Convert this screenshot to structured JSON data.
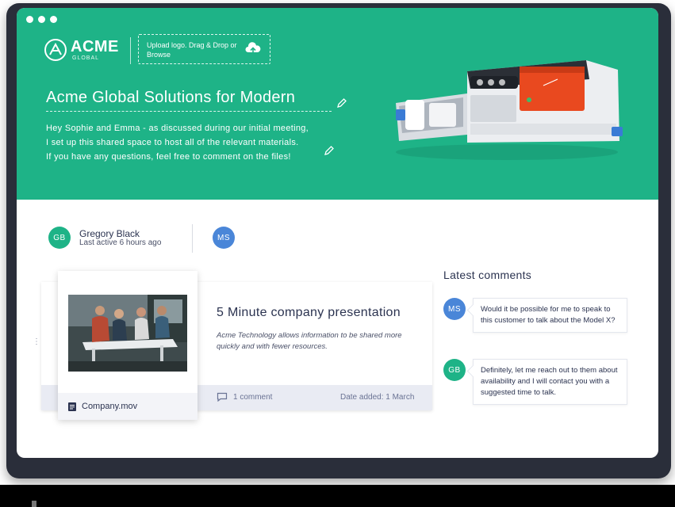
{
  "window": {
    "traffic_lights": [
      "dot",
      "dot",
      "dot"
    ]
  },
  "header": {
    "logo_word": "ACME",
    "logo_sub": "GLOBAL",
    "upload_text": "Upload logo. Drag & Drop or Browse",
    "upload_icon": "cloud-upload-icon",
    "title": "Acme Global Solutions for Modern",
    "description_lines": [
      "Hey Sophie and Emma - as discussed during our initial meeting,",
      "I set up this shared space to host all of the relevant materials.",
      "If you have any questions, feel free to comment on the files!"
    ],
    "edit_icon": "pencil-icon",
    "accent_color": "#1eb387"
  },
  "people": [
    {
      "initials": "GB",
      "name": "Gregory Black",
      "status": "Last active 6 hours ago",
      "color": "#1eb387"
    },
    {
      "initials": "MS",
      "color": "#4a86d8"
    }
  ],
  "card": {
    "title": "5 Minute company presentation",
    "description": "Acme Technology allows information to be shared more quickly and with fewer resources.",
    "comment_count": "1 comment",
    "date_added": "Date added: 1 March",
    "file_name": "Company.mov",
    "file_icon": "document-icon",
    "comment_icon": "speech-bubble-icon"
  },
  "comments": {
    "title": "Latest comments",
    "items": [
      {
        "initials": "MS",
        "color": "#4a86d8",
        "text": "Would it be possible for me to speak to this customer to talk about the Model X?"
      },
      {
        "initials": "GB",
        "color": "#1eb387",
        "text": "Definitely, let me reach out to them about availability and I will contact you with a suggested time to talk."
      }
    ]
  }
}
